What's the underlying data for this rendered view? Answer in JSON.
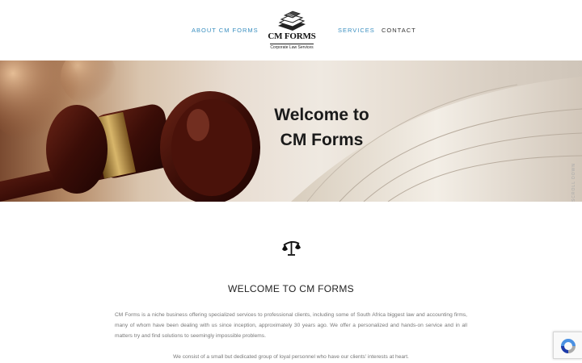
{
  "nav": {
    "about_label": "ABOUT CM FORMS",
    "services_label": "SERVICES",
    "contact_label": "CONTACT"
  },
  "logo": {
    "title": "CM FORMS",
    "tagline": "Corporate Law Services"
  },
  "hero": {
    "title_line1": "Welcome to",
    "title_line2": "CM Forms",
    "side_tag": "SCROLL DOWN"
  },
  "content": {
    "icon": "scales-of-justice-icon",
    "heading": "WELCOME TO CM FORMS",
    "paragraph1": "CM Forms is a niche business offering specialized services to professional clients, including some of South Africa biggest law and accounting firms, many of whom have been dealing with us since inception, approximately 30 years ago. We offer a personalized and hands-on service and in all matters try and find solutions to seemingly impossible problems.",
    "paragraph2": "We consist of a small but dedicated group of loyal personnel who have our clients' interests at heart."
  },
  "colors": {
    "nav_active": "#3a8fc0",
    "text_dark": "#222222",
    "text_muted": "#777777"
  },
  "widgets": {
    "recaptcha_icon": "recaptcha-icon"
  }
}
